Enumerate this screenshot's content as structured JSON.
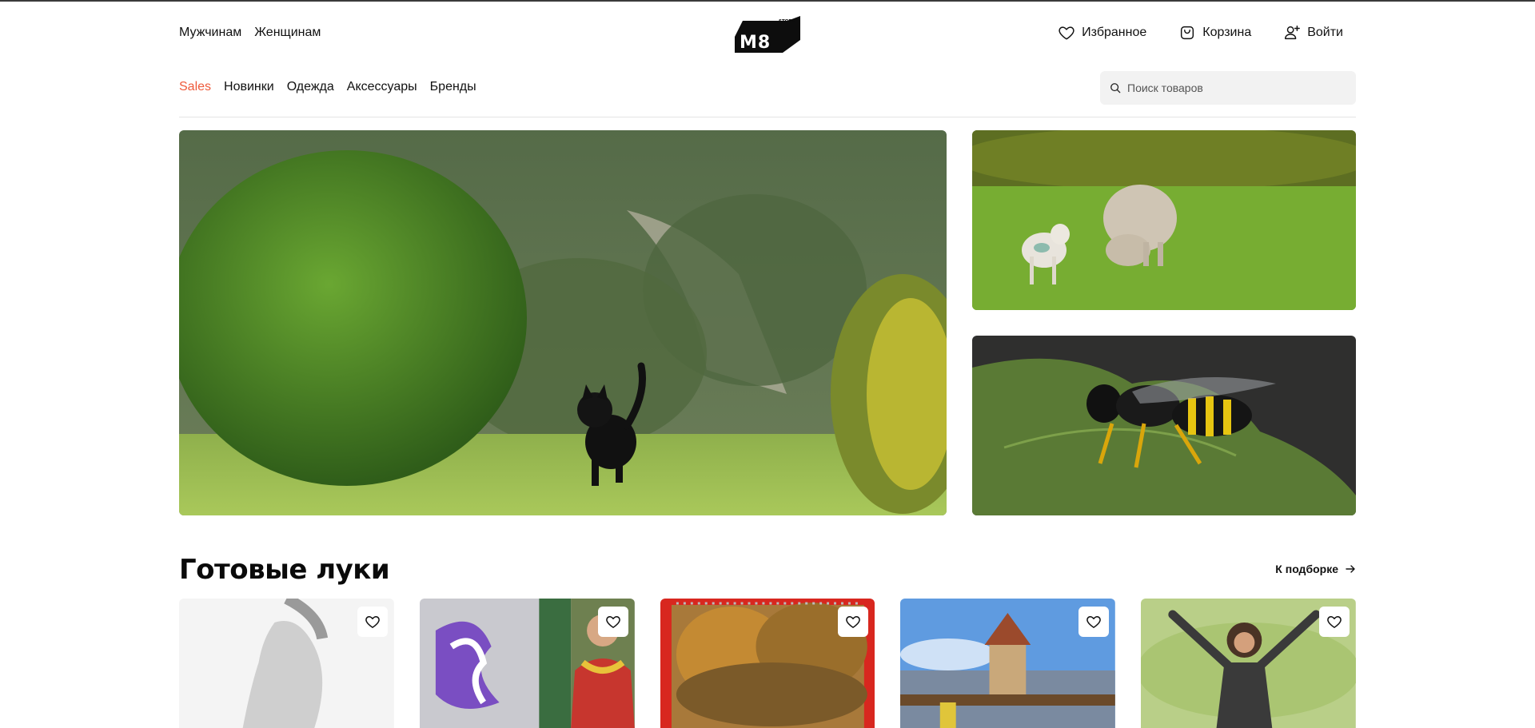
{
  "header": {
    "gender_nav": [
      "Мужчинам",
      "Женщинам"
    ],
    "logo": {
      "main": "M8",
      "sub": "STORE"
    },
    "user_nav": {
      "favorites": "Избранное",
      "cart": "Корзина",
      "login": "Войти"
    }
  },
  "categories": [
    "Sales",
    "Новинки",
    "Одежда",
    "Аксессуары",
    "Бренды"
  ],
  "search": {
    "placeholder": "Поиск товаров",
    "value": ""
  },
  "banners": [
    {
      "subject": "black cat walking on grass in a garden"
    },
    {
      "subject": "lamb and sheep grazing on a meadow"
    },
    {
      "subject": "wasp on a green leaf"
    }
  ],
  "looks_section": {
    "title": "Готовые луки",
    "see_all": "К подборке",
    "cards": [
      {
        "subject": "woman in white top (grayscale)"
      },
      {
        "subject": "graffiti wall and man in colorful scarf"
      },
      {
        "subject": "autumn trees photo calendar"
      },
      {
        "subject": "water tower and wooden bridge"
      },
      {
        "subject": "woman jumping in a green field"
      }
    ]
  },
  "colors": {
    "accent_sale": "#ee5a3b",
    "search_bg": "#f2f2f2",
    "text": "#111111"
  },
  "icons": [
    "heart-icon",
    "bag-icon",
    "user-plus-icon",
    "search-icon",
    "arrow-right-icon"
  ]
}
